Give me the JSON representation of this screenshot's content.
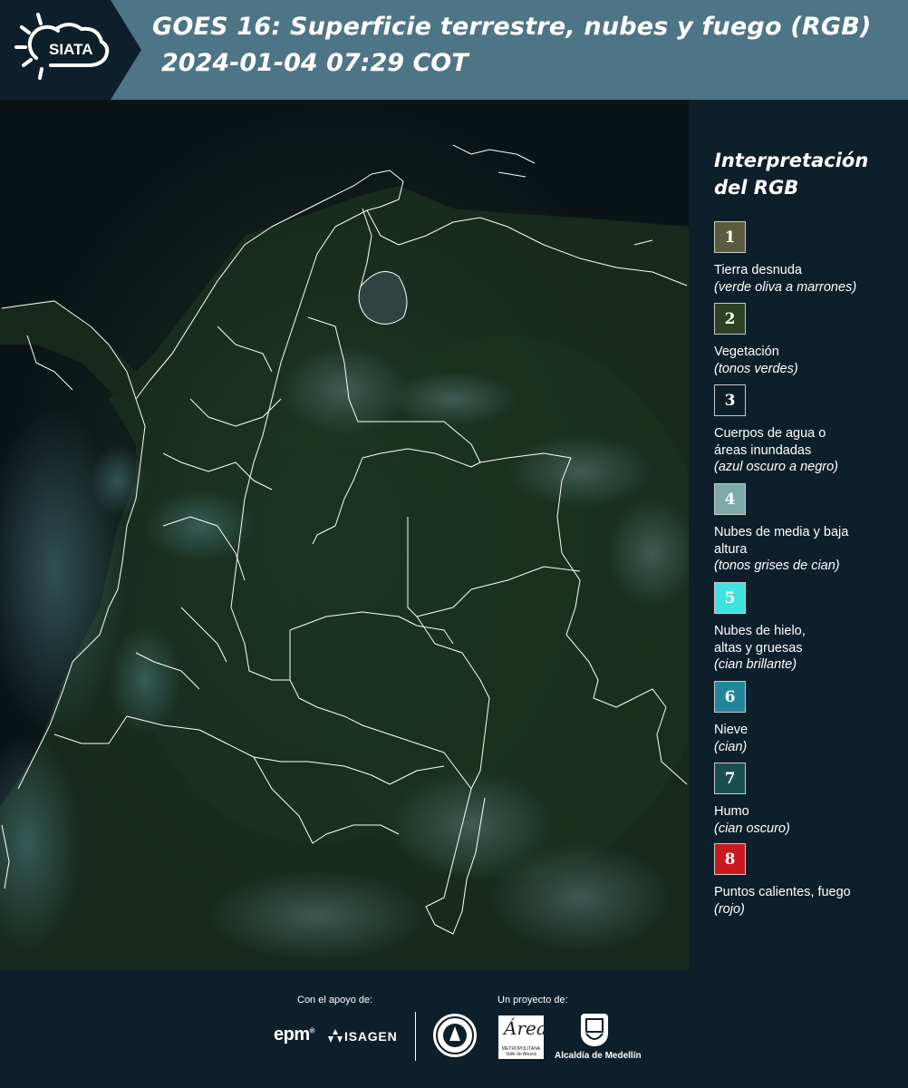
{
  "header": {
    "logo_text": "SIATA",
    "title_line1": "GOES 16: Superficie terrestre, nubes y fuego (RGB)",
    "title_line2": "2024-01-04 07:29 COT"
  },
  "legend": {
    "title": "Interpretación del RGB",
    "items": [
      {
        "number": "1",
        "label": "Tierra desnuda",
        "sub": "(verde oliva a marrones)",
        "color": "#5b5c3f"
      },
      {
        "number": "2",
        "label": "Vegetación",
        "sub": "(tonos verdes)",
        "color": "#2c4223"
      },
      {
        "number": "3",
        "label": "Cuerpos de agua o áreas inundadas",
        "sub": "(azul oscuro a negro)",
        "color": "#0d1f2b"
      },
      {
        "number": "4",
        "label": "Nubes de media y baja altura",
        "sub": "(tonos grises de cian)",
        "color": "#7eaaa8"
      },
      {
        "number": "5",
        "label": "Nubes de hielo, altas y gruesas",
        "sub": "(cian brillante)",
        "color": "#3ee3e0"
      },
      {
        "number": "6",
        "label": "Nieve",
        "sub": "(cian)",
        "color": "#21869a"
      },
      {
        "number": "7",
        "label": "Humo",
        "sub": "(cian oscuro)",
        "color": "#1b4e50"
      },
      {
        "number": "8",
        "label": "Puntos calientes, fuego",
        "sub": "(rojo)",
        "color": "#c8191e"
      }
    ]
  },
  "footer": {
    "support_label": "Con el apoyo de:",
    "project_label": "Un proyecto de:",
    "epm": "epm",
    "isagen": "ISAGEN",
    "amva_script": "Área",
    "amva_text": "METROPOLITANA Valle de Aburrá",
    "medellin": "Alcaldía de Medellín"
  },
  "colors": {
    "header_bg": "#4d7585",
    "panel_bg": "#0d1f2b",
    "map_land": "#15261b",
    "map_water": "#0a1417"
  }
}
